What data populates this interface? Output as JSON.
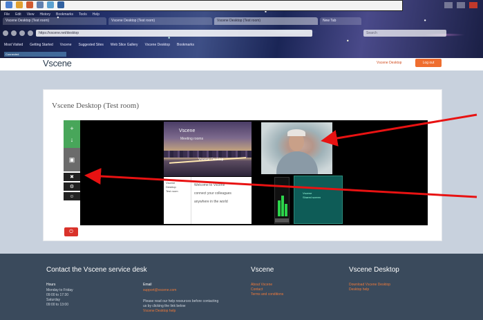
{
  "browser": {
    "menu": [
      "File",
      "Edit",
      "View",
      "History",
      "Bookmarks",
      "Tools",
      "Help"
    ],
    "tabs": [
      {
        "label": "Vscene Desktop (Test room)",
        "active": false
      },
      {
        "label": "Vscene Desktop (Test room)",
        "active": false
      },
      {
        "label": "Vscene Desktop (Test room)",
        "active": true
      },
      {
        "label": "New Tab",
        "active": false
      }
    ],
    "address": "https://vscene.net/desktop",
    "search_placeholder": "Search",
    "bookmarks": [
      "Most Visited",
      "Getting Started",
      "Vscene",
      "Suggested Sites",
      "Web Slice Gallery",
      "Vscene Desktop",
      "Bookmarks"
    ],
    "status": "Connected"
  },
  "site": {
    "logo": "Vscene",
    "header_link": "Vscene Desktop",
    "header_button": "Log out"
  },
  "room": {
    "title": "Vscene Desktop (Test room)",
    "tools": [
      "+",
      "↓",
      "▣",
      "✖",
      "⚙",
      "☺"
    ],
    "leave_label": "⏻",
    "shared_caption": "Vscene",
    "shared_sub": "Meeting rooms",
    "shared_overlay": "Vscene Desktop",
    "doc_left": [
      "Vscene",
      "Desktop",
      "Test room"
    ],
    "doc_lines": [
      "Welcome to Vscene",
      "connect your colleagues",
      "anywhere in the world"
    ],
    "teal_lines": [
      "Vscene",
      "Shared screen"
    ],
    "meter_levels": [
      0.45,
      0.6,
      0.35
    ]
  },
  "footer": {
    "contact_title": "Contact the Vscene service desk",
    "hours_label": "Hours",
    "hours_lines": [
      "Monday to Friday",
      "09:00 to 17:30",
      "Saturday",
      "09:00 to 13:00"
    ],
    "email_label": "Email",
    "email": "support@vscene.com",
    "note_lines": [
      "Please read our help resources before contacting",
      "us by clicking the link below",
      "Vscene Desktop help"
    ],
    "col2_title": "Vscene",
    "col2_links": [
      "About Vscene",
      "Contact",
      "Terms and conditions"
    ],
    "col3_title": "Vscene Desktop",
    "col3_links": [
      "Download Vscene Desktop",
      "Desktop help"
    ]
  },
  "colors": {
    "accent": "#ef6e2f",
    "arrow": "#e81212",
    "content_bg": "#c8d1dd",
    "footer_bg": "#3a4a5c"
  }
}
